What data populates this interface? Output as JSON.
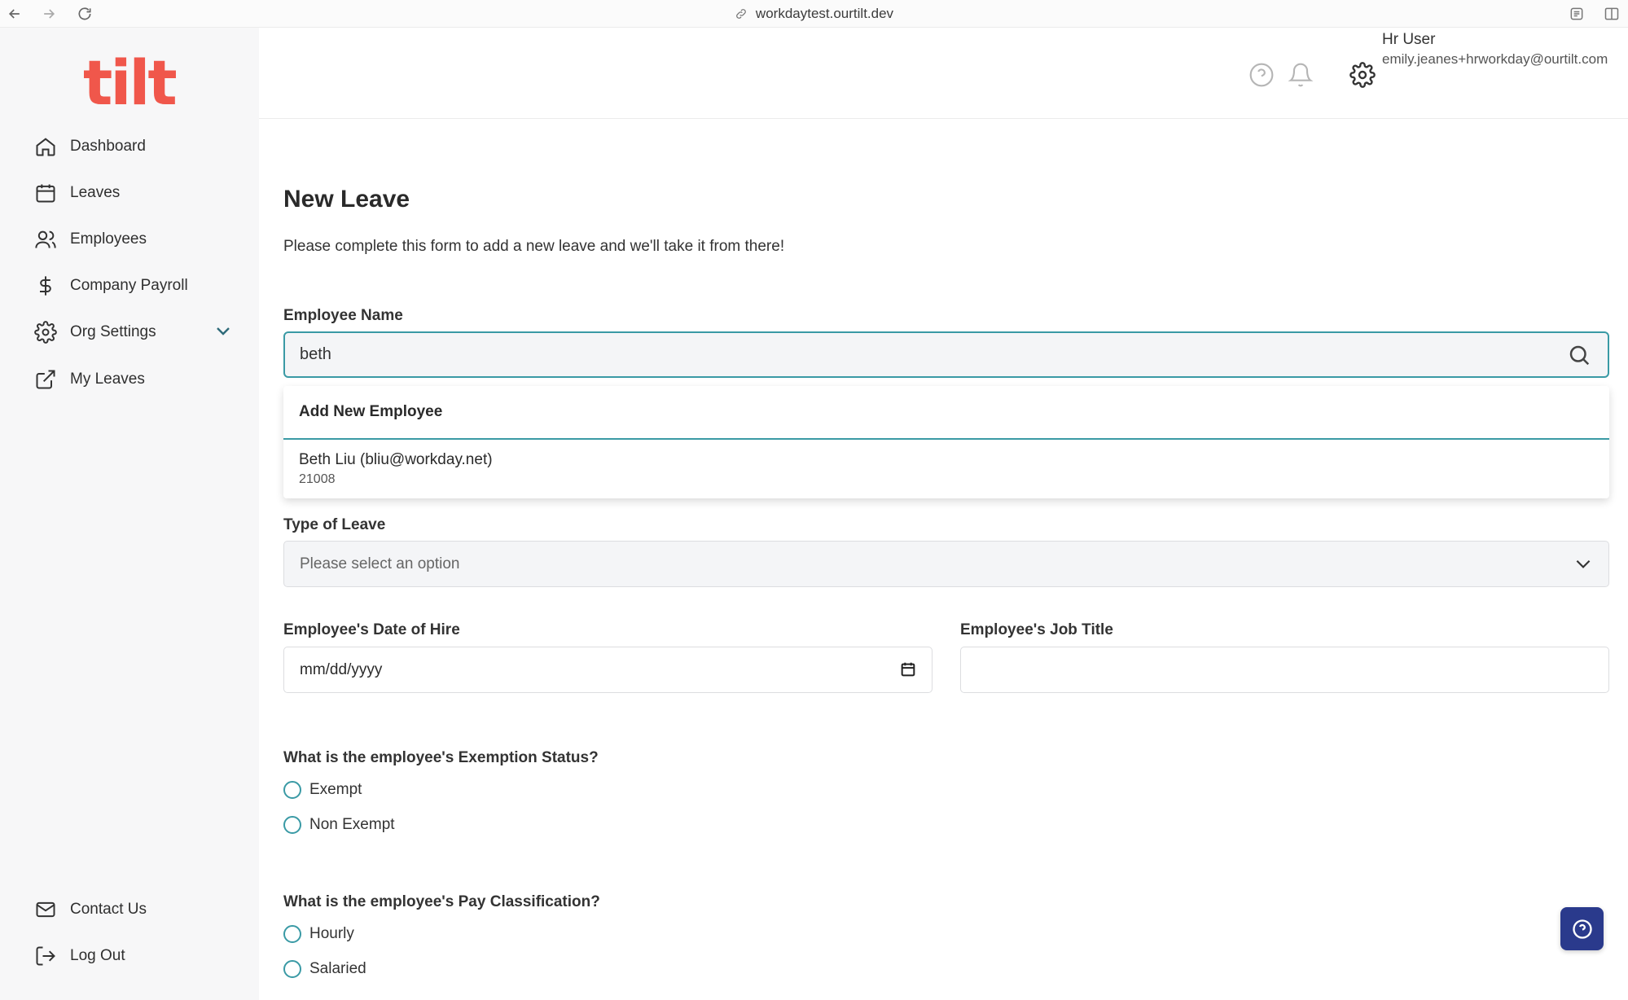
{
  "browser": {
    "url": "workdaytest.ourtilt.dev"
  },
  "brand": {
    "logo_text": "tilt",
    "accent": "#f0574b",
    "focus": "#3a9aa5"
  },
  "sidebar": {
    "items": [
      {
        "label": "Dashboard",
        "icon": "home-icon"
      },
      {
        "label": "Leaves",
        "icon": "calendar-icon"
      },
      {
        "label": "Employees",
        "icon": "users-icon"
      },
      {
        "label": "Company Payroll",
        "icon": "dollar-icon"
      },
      {
        "label": "Org Settings",
        "icon": "gear-icon"
      },
      {
        "label": "My Leaves",
        "icon": "external-link-icon"
      }
    ],
    "footer": [
      {
        "label": "Contact Us",
        "icon": "mail-icon"
      },
      {
        "label": "Log Out",
        "icon": "logout-icon"
      }
    ]
  },
  "header": {
    "user_name": "Hr User",
    "user_email": "emily.jeanes+hrworkday@ourtilt.com"
  },
  "form": {
    "title": "New Leave",
    "subtitle": "Please complete this form to add a new leave and we'll take it from there!",
    "employee_name_label": "Employee Name",
    "employee_search_value": "beth",
    "dropdown": {
      "add_new": "Add New Employee",
      "options": [
        {
          "name": "Beth Liu (bliu@workday.net)",
          "id": "21008"
        }
      ]
    },
    "type_of_leave_label": "Type of Leave",
    "type_of_leave_placeholder": "Please select an option",
    "date_of_hire_label": "Employee's Date of Hire",
    "date_of_hire_value": "mm/dd/yyyy",
    "job_title_label": "Employee's Job Title",
    "job_title_value": "",
    "exemption_label": "What is the employee's Exemption Status?",
    "exemption_options": [
      "Exempt",
      "Non Exempt"
    ],
    "pay_label": "What is the employee's Pay Classification?",
    "pay_options": [
      "Hourly",
      "Salaried"
    ]
  }
}
